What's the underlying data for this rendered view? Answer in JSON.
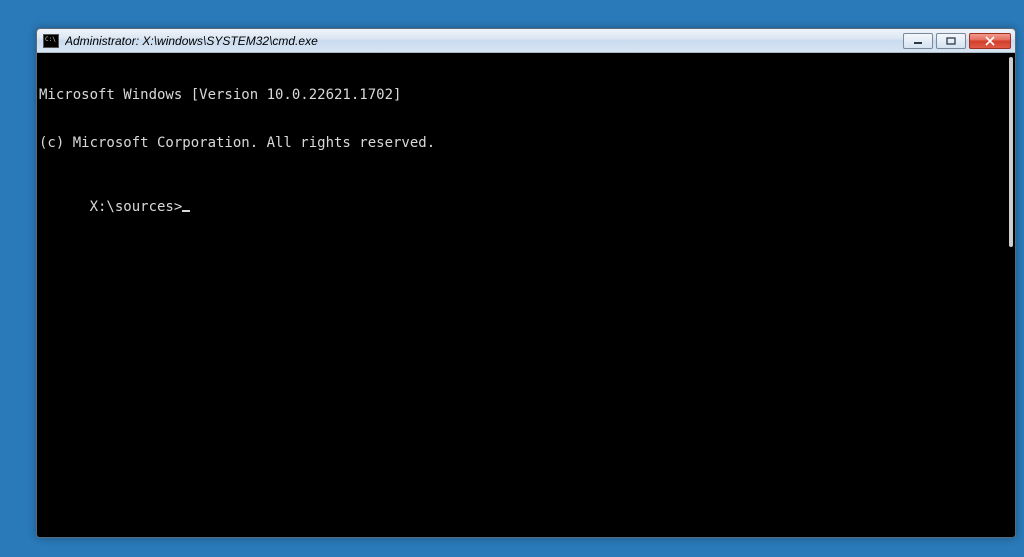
{
  "window": {
    "title": "Administrator: X:\\windows\\SYSTEM32\\cmd.exe"
  },
  "terminal": {
    "lines": [
      "Microsoft Windows [Version 10.0.22621.1702]",
      "(c) Microsoft Corporation. All rights reserved.",
      ""
    ],
    "prompt": "X:\\sources>",
    "input": ""
  }
}
